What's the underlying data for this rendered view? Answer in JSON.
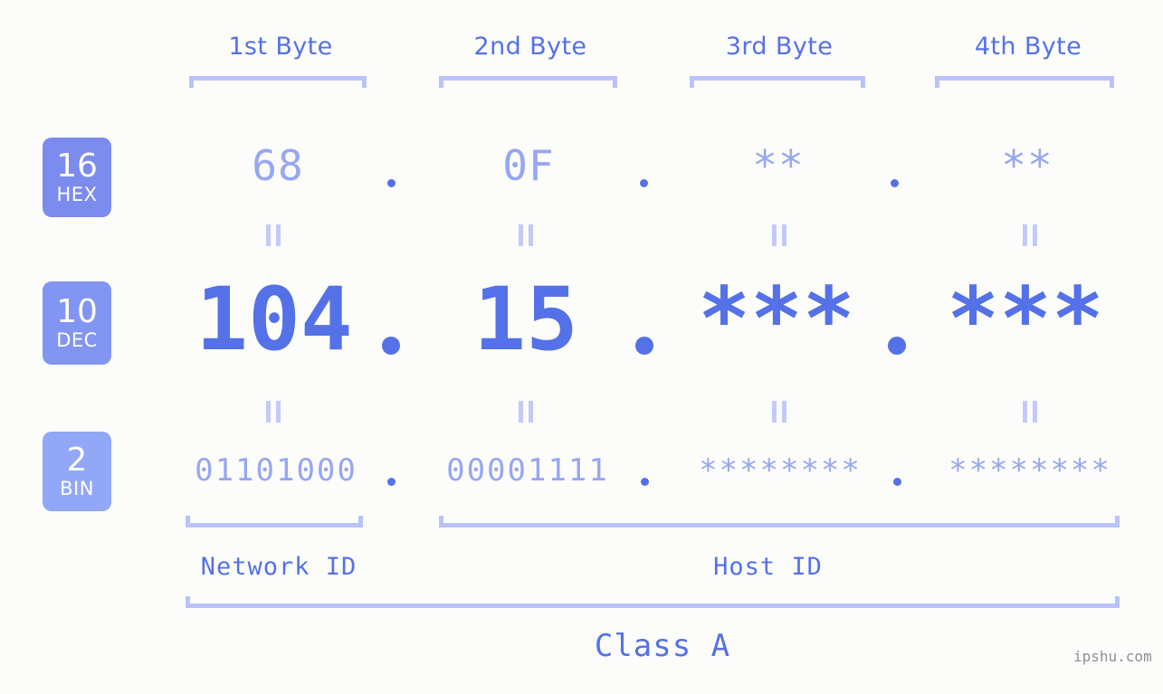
{
  "background_color": "#fcfdfa",
  "accent_color": "#5571e8",
  "muted_accent_color": "#97a6f4",
  "bracket_color": "#b9c2fb",
  "headers": [
    {
      "label": "1st Byte"
    },
    {
      "label": "2nd Byte"
    },
    {
      "label": "3rd Byte"
    },
    {
      "label": "4th Byte"
    }
  ],
  "bases": [
    {
      "number": "16",
      "name": "HEX",
      "color": "#7c8bee"
    },
    {
      "number": "10",
      "name": "DEC",
      "color": "#8295f2"
    },
    {
      "number": "2",
      "name": "BIN",
      "color": "#92a7f7"
    }
  ],
  "rows": {
    "hex": {
      "values": [
        "68",
        "0F",
        "**",
        "**"
      ],
      "separator": "."
    },
    "dec": {
      "values": [
        "104",
        "15",
        "***",
        "***"
      ],
      "separator": "."
    },
    "bin": {
      "values": [
        "01101000",
        "00001111",
        "********",
        "********"
      ],
      "separator": "."
    }
  },
  "equals_marker": "||",
  "segments": [
    {
      "label": "Network ID"
    },
    {
      "label": "Host ID"
    }
  ],
  "class_label": "Class A",
  "watermark": "ipshu.com"
}
